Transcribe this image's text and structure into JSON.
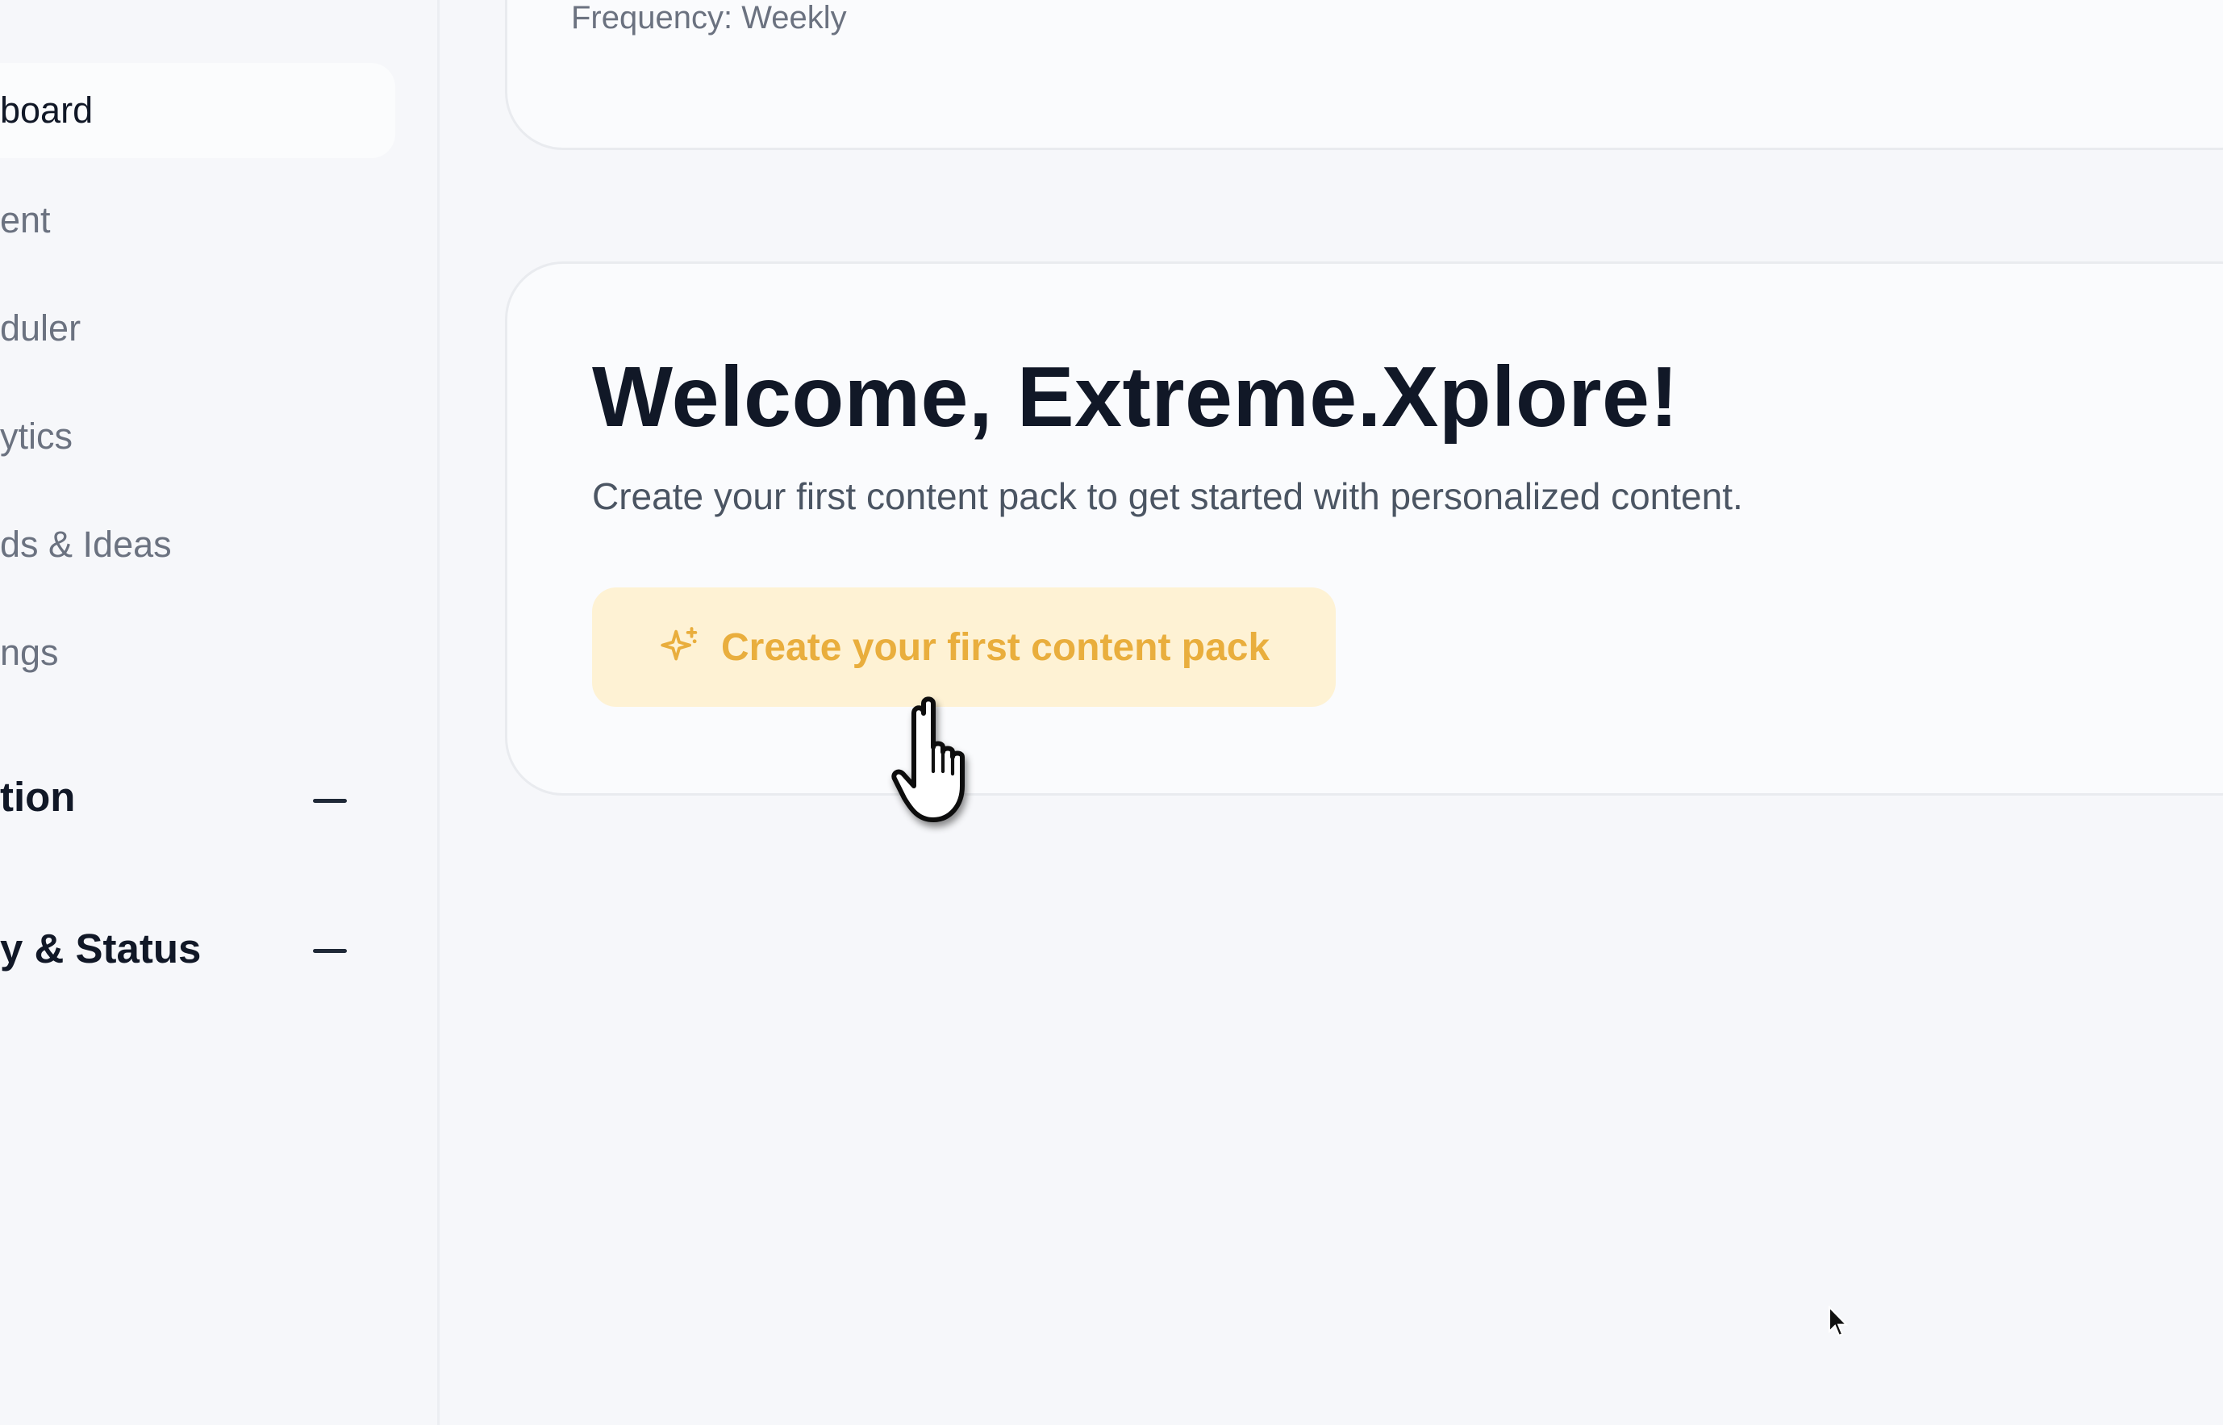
{
  "sidebar": {
    "items": [
      {
        "label": "board",
        "active": true
      },
      {
        "label": "ent",
        "active": false
      },
      {
        "label": "duler",
        "active": false
      },
      {
        "label": "ytics",
        "active": false
      },
      {
        "label": "ds & Ideas",
        "active": false
      },
      {
        "label": "ngs",
        "active": false
      }
    ],
    "sections": [
      {
        "title": "tion",
        "icon": "minus-icon"
      },
      {
        "title": "y & Status",
        "icon": "minus-icon"
      }
    ]
  },
  "top_card": {
    "frequency": "Frequency: Weekly"
  },
  "welcome": {
    "title": "Welcome, Extreme.Xplore!",
    "subtitle": "Create your first content pack to get started with personalized content.",
    "cta_label": "Create your first content pack",
    "cta_icon": "sparkles-icon"
  },
  "colors": {
    "accent": "#e9ae3d",
    "cta_background": "#fef2d4",
    "text_primary": "#111827",
    "text_secondary": "#6b7280"
  }
}
